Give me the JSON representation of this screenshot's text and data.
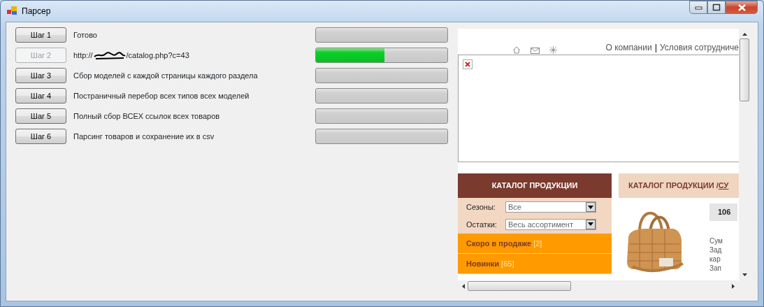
{
  "window": {
    "title": "Парсер"
  },
  "steps": [
    {
      "button": "Шаг 1",
      "disabled": false,
      "kind": "text",
      "status": "Готово",
      "level": 0
    },
    {
      "button": "Шаг 2",
      "disabled": true,
      "kind": "url",
      "url_prefix": "http://",
      "url_path": "/catalog.php?c=43",
      "level": 0.52
    },
    {
      "button": "Шаг 3",
      "disabled": false,
      "kind": "text",
      "status": "Сбор моделей с каждой страницы каждого раздела",
      "level": 0
    },
    {
      "button": "Шаг 4",
      "disabled": false,
      "kind": "text",
      "status": "Постраничный перебор всех типов всех моделей",
      "level": 0
    },
    {
      "button": "Шаг 5",
      "disabled": false,
      "kind": "text",
      "status": "Полный сбор ВСЕХ ссылок всех товаров",
      "level": 0
    },
    {
      "button": "Шаг 6",
      "disabled": false,
      "kind": "text",
      "status": "Парсинг товаров и сохранение их в csv",
      "level": 0
    }
  ],
  "browser": {
    "top_links": [
      {
        "kind": "link",
        "text": "О компании"
      },
      {
        "kind": "separator",
        "text": "|"
      },
      {
        "kind": "link",
        "text": "Условия сотрудниче"
      }
    ],
    "sidebar": {
      "title": "КАТАЛОГ ПРОДУКЦИИ",
      "filters": [
        {
          "label": "Сезоны:",
          "value": "Все"
        },
        {
          "label": "Остатки:",
          "value": "Весь ассортимент"
        }
      ],
      "categories": [
        {
          "name": "Скоро в продаже",
          "count": "[2]"
        },
        {
          "name": "Новинки",
          "count": "[65]"
        }
      ]
    },
    "breadcrumb": {
      "text": "КАТАЛОГ ПРОДУКЦИИ / ",
      "link": "СУ"
    },
    "product": {
      "code": "106",
      "description_lines": [
        "Сум",
        "Зад",
        "кар",
        "Зап"
      ]
    }
  }
}
